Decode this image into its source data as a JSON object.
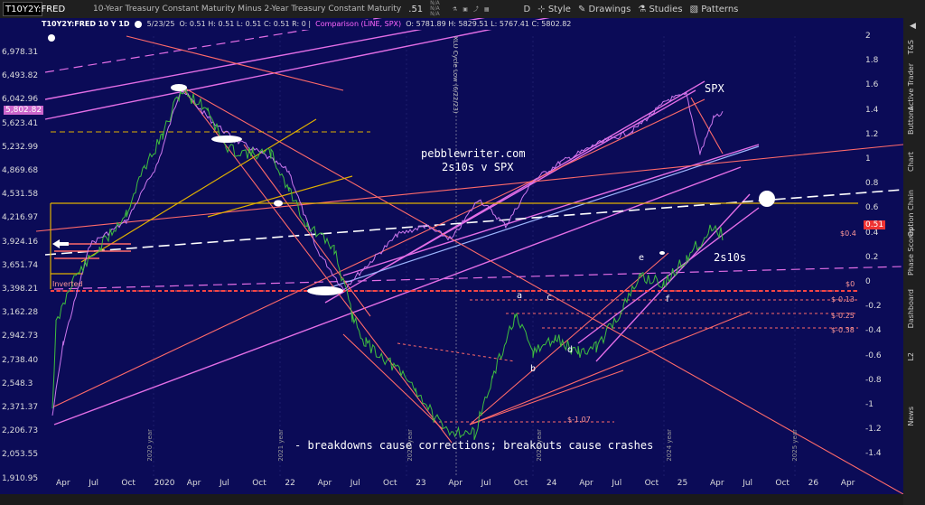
{
  "toolbar": {
    "symbol": "T10Y2Y:FRED",
    "name": "10-Year Treasury Constant Maturity Minus 2-Year Treasury Constant Maturity",
    "last": ".51",
    "na1": "N/A",
    "na2": "N/A",
    "na3": "N/A",
    "interval": "D",
    "style": "Style",
    "drawings": "Drawings",
    "studies": "Studies",
    "patterns": "Patterns"
  },
  "info": {
    "title": "T10Y2Y:FRED 10 Y 1D",
    "date": "5/23/25",
    "o": "O: 0.51",
    "h": "H: 0.51",
    "l": "L: 0.51",
    "c": "C: 0.51",
    "r": "R: 0",
    "comparison": "Comparison (LINE, SPX)",
    "co": "O: 5781.89",
    "ch": "H: 5829.51",
    "cl": "L: 5767.41",
    "cc": "C: 5802.82"
  },
  "left_axis": [
    "6,978.31",
    "6,493.82",
    "6,042.96",
    "5,623.41",
    "5,232.99",
    "4,869.68",
    "4,531.58",
    "4,216.97",
    "3,924.16",
    "3,651.74",
    "3,398.21",
    "3,162.28",
    "2,942.73",
    "2,738.40",
    "2,548.3",
    "2,371.37",
    "2,206.73",
    "2,053.55",
    "1,910.95"
  ],
  "right_axis": [
    "2",
    "1.8",
    "1.6",
    "1.4",
    "1.2",
    "1",
    "0.8",
    "0.6",
    "0.4",
    "0.2",
    "0",
    "-0.2",
    "-0.4",
    "-0.6",
    "-0.8",
    "-1",
    "-1.2",
    "-1.4"
  ],
  "x_axis": [
    "Apr",
    "Jul",
    "Oct",
    "2020",
    "Apr",
    "Jul",
    "Oct",
    "22",
    "Apr",
    "Jul",
    "Oct",
    "23",
    "Apr",
    "Jul",
    "Oct",
    "24",
    "Apr",
    "Jul",
    "Oct",
    "25",
    "Apr",
    "Jul",
    "Oct",
    "26",
    "Apr"
  ],
  "price_badges": {
    "spx": "5,802.82",
    "spread": "0.51"
  },
  "annotations": {
    "spx": "SPX",
    "site": "pebblewriter.com",
    "sub": "2s10s v SPX",
    "spread": "2s10s",
    "note": "- breakdowns cause corrections; breakouts cause crashes",
    "inverted": "Inverted",
    "a": "a",
    "b": "b",
    "c": "c",
    "d": "d",
    "e": "e",
    "f": "f",
    "xlu": "XLU Cycle Low (6/22/23)"
  },
  "level_tags": [
    "$0.4",
    "$0",
    "$-0.13",
    "$-0.25",
    "$-0.38",
    "$-1.07"
  ],
  "year_marks": [
    "2020 year",
    "2021 year",
    "2022 year",
    "2023 year",
    "2024 year",
    "2025 year"
  ],
  "sidebar": [
    "T&S",
    "Active Trader",
    "Buttons",
    "Chart",
    "Option Chain",
    "Phase Scores",
    "Dashboard",
    "L2",
    "News"
  ],
  "colors": {
    "bg": "#0b0b57",
    "spx_line": "#cc77ee",
    "spread_line": "#3fbf3f",
    "trend_red": "#ff6a6a",
    "channel": "#e36ee6",
    "gold": "#e0b000"
  }
}
